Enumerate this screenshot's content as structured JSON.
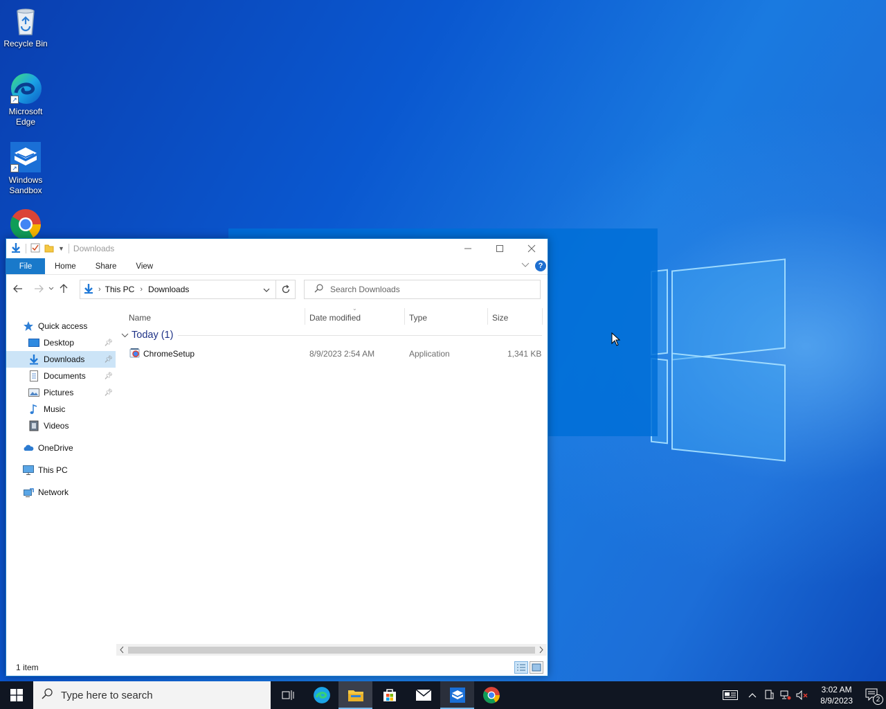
{
  "desktop": {
    "icons": [
      {
        "label": "Recycle Bin",
        "icon": "recycle-bin-icon"
      },
      {
        "label": "Microsoft Edge",
        "icon": "edge-icon"
      },
      {
        "label": "Windows Sandbox",
        "icon": "sandbox-icon"
      },
      {
        "label": "",
        "icon": "chrome-icon"
      }
    ]
  },
  "explorer": {
    "title": "Downloads",
    "ribbon": {
      "file": "File",
      "home": "Home",
      "share": "Share",
      "view": "View"
    },
    "address": {
      "segments": [
        "This PC",
        "Downloads"
      ]
    },
    "search": {
      "placeholder": "Search Downloads"
    },
    "nav": {
      "quick_access": "Quick access",
      "desktop": "Desktop",
      "downloads": "Downloads",
      "documents": "Documents",
      "pictures": "Pictures",
      "music": "Music",
      "videos": "Videos",
      "onedrive": "OneDrive",
      "this_pc": "This PC",
      "network": "Network"
    },
    "columns": {
      "name": "Name",
      "date_modified": "Date modified",
      "type": "Type",
      "size": "Size"
    },
    "group": {
      "label": "Today (1)"
    },
    "files": [
      {
        "name": "ChromeSetup",
        "date": "8/9/2023 2:54 AM",
        "type": "Application",
        "size": "1,341 KB"
      }
    ],
    "status": "1 item"
  },
  "taskbar": {
    "search_placeholder": "Type here to search",
    "apps": [
      "task-view-icon",
      "edge-icon",
      "file-explorer-icon",
      "store-icon",
      "mail-icon",
      "sandbox-icon",
      "chrome-icon"
    ],
    "active_app": "file-explorer-icon",
    "clock": {
      "time": "3:02 AM",
      "date": "8/9/2023"
    },
    "notification_count": "2"
  },
  "colors": {
    "accent": "#1979ca",
    "selection": "#cce4f7",
    "taskbar": "#101622",
    "wallpaper": "#0a58d0"
  }
}
